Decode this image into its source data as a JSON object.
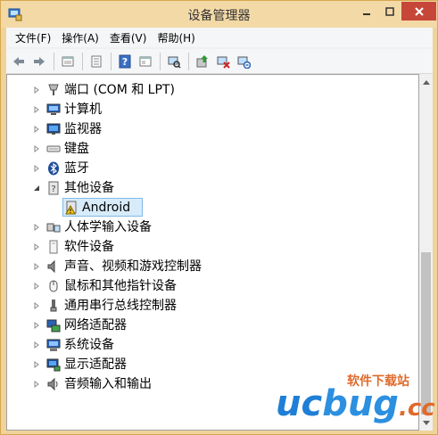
{
  "window": {
    "title": "设备管理器",
    "app_icon": "device-manager-icon",
    "colors": {
      "frame": "#f0d39a",
      "close_button": "#c7463a",
      "selection": "#d7ebfa",
      "selection_border": "#7fbae8"
    }
  },
  "menu": {
    "items": [
      {
        "label": "文件(F)"
      },
      {
        "label": "操作(A)"
      },
      {
        "label": "查看(V)"
      },
      {
        "label": "帮助(H)"
      }
    ]
  },
  "toolbar": {
    "buttons": [
      "back-arrow-icon",
      "forward-arrow-icon",
      "properties-sheet-icon",
      "details-pane-icon",
      "help-icon",
      "console-view-icon",
      "scan-hardware-icon",
      "update-driver-icon",
      "disable-device-icon",
      "uninstall-device-icon"
    ]
  },
  "tree": {
    "nodes": [
      {
        "label": "端口 (COM 和 LPT)",
        "icon": "port-icon",
        "expanded": false
      },
      {
        "label": "计算机",
        "icon": "computer-icon",
        "expanded": false
      },
      {
        "label": "监视器",
        "icon": "monitor-icon",
        "expanded": false
      },
      {
        "label": "键盘",
        "icon": "keyboard-icon",
        "expanded": false
      },
      {
        "label": "蓝牙",
        "icon": "bluetooth-icon",
        "expanded": false
      },
      {
        "label": "其他设备",
        "icon": "unknown-device-icon",
        "expanded": true
      },
      {
        "label": "Android",
        "icon": "warning-device-icon",
        "child": true,
        "selected": true
      },
      {
        "label": "人体学输入设备",
        "icon": "hid-icon",
        "expanded": false
      },
      {
        "label": "软件设备",
        "icon": "software-device-icon",
        "expanded": false
      },
      {
        "label": "声音、视频和游戏控制器",
        "icon": "speaker-icon",
        "expanded": false
      },
      {
        "label": "鼠标和其他指针设备",
        "icon": "mouse-icon",
        "expanded": false
      },
      {
        "label": "通用串行总线控制器",
        "icon": "usb-icon",
        "expanded": false
      },
      {
        "label": "网络适配器",
        "icon": "network-adapter-icon",
        "expanded": false
      },
      {
        "label": "系统设备",
        "icon": "system-device-icon",
        "expanded": false
      },
      {
        "label": "显示适配器",
        "icon": "display-adapter-icon",
        "expanded": false
      },
      {
        "label": "音频输入和输出",
        "icon": "audio-io-icon",
        "expanded": false
      }
    ]
  },
  "watermark": {
    "top_text": "软件下载站",
    "logo_text_1": "uc",
    "logo_text_2": "bug",
    "logo_text_3": ".cc"
  }
}
